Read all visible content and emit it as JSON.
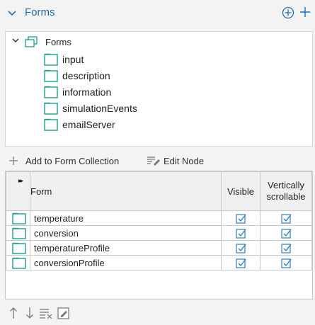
{
  "header": {
    "title": "Forms",
    "collapse_icon": "chevron-down-icon",
    "add_icon": "add-circle-icon",
    "plus_icon": "plus-icon"
  },
  "tree": {
    "root": {
      "label": "Forms",
      "icon": "forms-folder-icon"
    },
    "children": [
      {
        "label": "input"
      },
      {
        "label": "description"
      },
      {
        "label": "information"
      },
      {
        "label": "simulationEvents"
      },
      {
        "label": "emailServer"
      }
    ]
  },
  "toolbar": {
    "add_label": "Add to Form Collection",
    "edit_label": "Edit Node"
  },
  "grid": {
    "columns": {
      "mark": "▸▸",
      "form": "Form",
      "visible": "Visible",
      "scroll_line1": "Vertically",
      "scroll_line2": "scrollable"
    },
    "rows": [
      {
        "name": "temperature",
        "visible": true,
        "scrollable": true
      },
      {
        "name": "conversion",
        "visible": true,
        "scrollable": true
      },
      {
        "name": "temperatureProfile",
        "visible": true,
        "scrollable": true
      },
      {
        "name": "conversionProfile",
        "visible": true,
        "scrollable": true
      }
    ]
  },
  "bottombar": {
    "icons": [
      "move-up-icon",
      "move-down-icon",
      "clear-list-icon",
      "edit-icon"
    ]
  },
  "colors": {
    "accent": "#1f6fb5",
    "folder": "#1f9e8e",
    "check": "#2f7fc1"
  }
}
